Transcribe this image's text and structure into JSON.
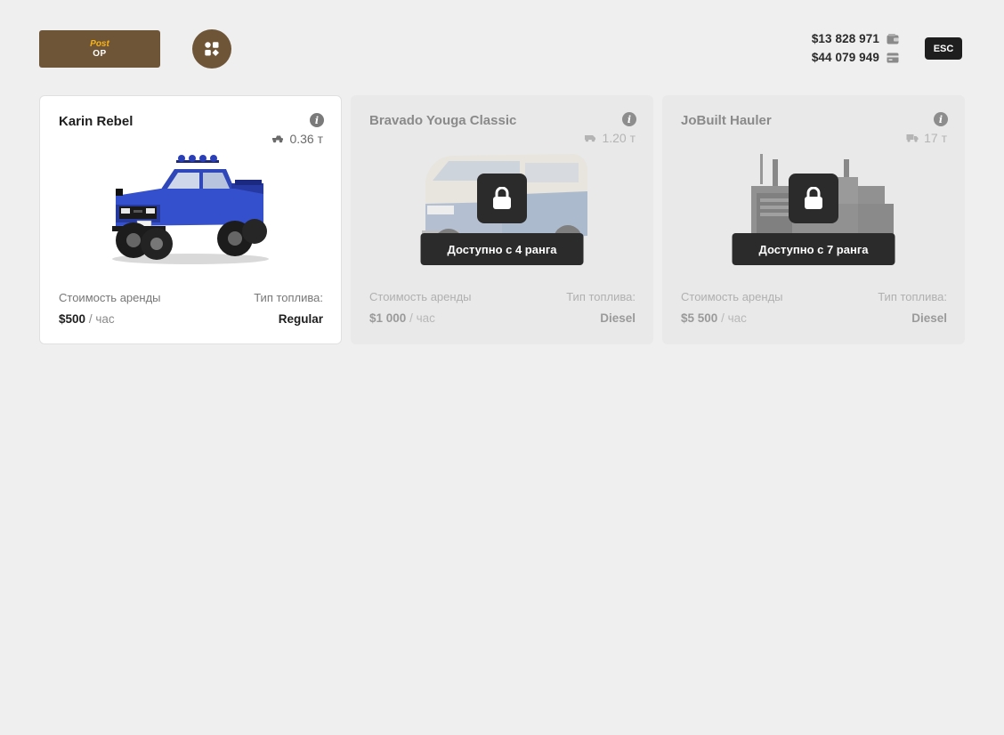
{
  "header": {
    "logo_top": "Post",
    "logo_bottom": "OP",
    "menu_icon": "grid-shapes-icon",
    "esc_label": "ESC",
    "balance": {
      "cash": "$13 828 971",
      "cash_icon": "wallet-icon",
      "bank": "$44 079 949",
      "bank_icon": "card-icon"
    }
  },
  "colors": {
    "accent": "#6e5537",
    "logo_highlight": "#f5b31a",
    "dark": "#2b2b2b",
    "background": "#efefef"
  },
  "cards": [
    {
      "title": "Karin Rebel",
      "capacity": "0.36 т",
      "capacity_icon": "pickup-icon",
      "rent_label": "Стоимость аренды",
      "rent_price": "$500",
      "rent_unit": "/ час",
      "fuel_label": "Тип топлива:",
      "fuel_value": "Regular",
      "locked": false
    },
    {
      "title": "Bravado Youga Classic",
      "capacity": "1.20 т",
      "capacity_icon": "van-icon",
      "rent_label": "Стоимость аренды",
      "rent_price": "$1 000",
      "rent_unit": "/ час",
      "fuel_label": "Тип топлива:",
      "fuel_value": "Diesel",
      "locked": true,
      "lock_text": "Доступно с 4 ранга"
    },
    {
      "title": "JoBuilt Hauler",
      "capacity": "17 т",
      "capacity_icon": "truck-icon",
      "rent_label": "Стоимость аренды",
      "rent_price": "$5 500",
      "rent_unit": "/ час",
      "fuel_label": "Тип топлива:",
      "fuel_value": "Diesel",
      "locked": true,
      "lock_text": "Доступно с 7 ранга"
    }
  ]
}
